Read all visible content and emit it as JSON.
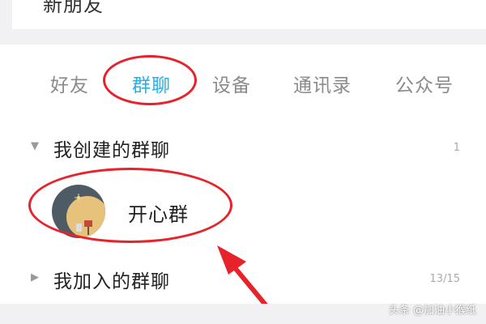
{
  "top": {
    "partial_text": "新朋友"
  },
  "tabs": [
    {
      "label": "好友",
      "active": false
    },
    {
      "label": "群聊",
      "active": true
    },
    {
      "label": "设备",
      "active": false
    },
    {
      "label": "通讯录",
      "active": false
    },
    {
      "label": "公众号",
      "active": false
    }
  ],
  "sections": {
    "created": {
      "label": "我创建的群聊",
      "count": "1",
      "expanded": true
    },
    "joined": {
      "label": "我加入的群聊",
      "count": "13/15",
      "expanded": false
    }
  },
  "groups": [
    {
      "name": "开心群",
      "avatar_icon": "moon-night-avatar-icon"
    }
  ],
  "watermark": "头条 @加油小猴纸",
  "colors": {
    "accent": "#1fb3f0",
    "annotation": "#e8222b",
    "tab_inactive": "#8a8a8a",
    "background_strip": "#f1f1f3"
  }
}
